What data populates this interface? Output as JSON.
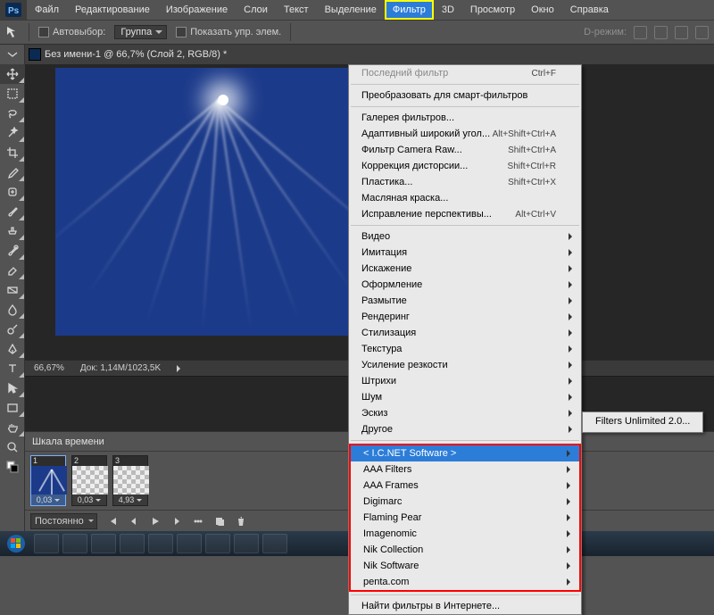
{
  "menubar": {
    "items": [
      "Файл",
      "Редактирование",
      "Изображение",
      "Слои",
      "Текст",
      "Выделение",
      "Фильтр",
      "3D",
      "Просмотр",
      "Окно",
      "Справка"
    ],
    "open_index": 6
  },
  "optionsbar": {
    "auto_select": "Автовыбор:",
    "group": "Группа",
    "show_transform": "Показать упр. элем.",
    "mode_label": "D-режим:"
  },
  "document": {
    "tab_title": "Без имени-1 @ 66,7% (Слой 2, RGB/8) *",
    "zoom": "66,67%",
    "doc_size_label": "Док:",
    "doc_size_value": "1,14M/1023,5K"
  },
  "filter_menu": {
    "last_filter": {
      "label": "Последний фильтр",
      "shortcut": "Ctrl+F"
    },
    "convert_smart": "Преобразовать для смарт-фильтров",
    "group1": [
      {
        "label": "Галерея фильтров..."
      },
      {
        "label": "Адаптивный широкий угол...",
        "shortcut": "Alt+Shift+Ctrl+A"
      },
      {
        "label": "Фильтр Camera Raw...",
        "shortcut": "Shift+Ctrl+A"
      },
      {
        "label": "Коррекция дисторсии...",
        "shortcut": "Shift+Ctrl+R"
      },
      {
        "label": "Пластика...",
        "shortcut": "Shift+Ctrl+X"
      },
      {
        "label": "Масляная краска..."
      },
      {
        "label": "Исправление перспективы...",
        "shortcut": "Alt+Ctrl+V"
      }
    ],
    "group2": [
      "Видео",
      "Имитация",
      "Искажение",
      "Оформление",
      "Размытие",
      "Рендеринг",
      "Стилизация",
      "Текстура",
      "Усиление резкости",
      "Штрихи",
      "Шум",
      "Эскиз",
      "Другое"
    ],
    "group3": [
      "< I.C.NET Software >",
      "AAA Filters",
      "AAA Frames",
      "Digimarc",
      "Flaming Pear",
      "Imagenomic",
      "Nik Collection",
      "Nik Software",
      "penta.com"
    ],
    "highlight_index": 0,
    "find_online": "Найти фильтры в Интернете..."
  },
  "submenu": {
    "items": [
      "Filters Unlimited 2.0..."
    ]
  },
  "timeline": {
    "title": "Шкала времени",
    "frames": [
      {
        "n": "1",
        "dur": "0,03"
      },
      {
        "n": "2",
        "dur": "0,03"
      },
      {
        "n": "3",
        "dur": "4,93"
      }
    ],
    "loop": "Постоянно"
  }
}
